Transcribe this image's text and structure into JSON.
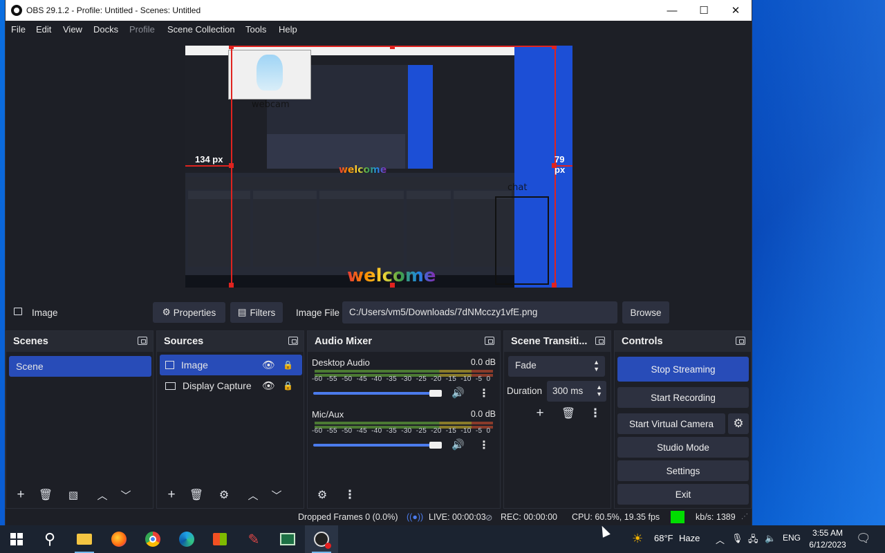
{
  "window": {
    "title": "OBS 29.1.2 - Profile: Untitled - Scenes: Untitled",
    "minimize": "—",
    "maximize": "☐",
    "close": "✕"
  },
  "menu": [
    "File",
    "Edit",
    "View",
    "Docks",
    "Profile",
    "Scene Collection",
    "Tools",
    "Help"
  ],
  "preview": {
    "left_gap_label": "134 px",
    "right_gap_label": "79 px",
    "webcam_label": "webcam",
    "welcome_text": "welcome",
    "chat_label": "chat"
  },
  "source_bar": {
    "source_name": "Image",
    "properties_label": "Properties",
    "filters_label": "Filters",
    "image_file_label": "Image File",
    "image_file_path": "C:/Users/vm5/Downloads/7dNMcczy1vfE.png",
    "browse_label": "Browse"
  },
  "scenes": {
    "title": "Scenes",
    "items": [
      "Scene"
    ]
  },
  "sources": {
    "title": "Sources",
    "items": [
      "Image",
      "Display Capture"
    ]
  },
  "audio_mixer": {
    "title": "Audio Mixer",
    "scale": [
      "-60",
      "-55",
      "-50",
      "-45",
      "-40",
      "-35",
      "-30",
      "-25",
      "-20",
      "-15",
      "-10",
      "-5",
      "0"
    ],
    "channels": [
      {
        "name": "Desktop Audio",
        "level": "0.0 dB",
        "volume": 0.93
      },
      {
        "name": "Mic/Aux",
        "level": "0.0 dB",
        "volume": 0.93
      }
    ]
  },
  "transitions": {
    "title": "Scene Transiti...",
    "selected": "Fade",
    "duration_label": "Duration",
    "duration_value": "300 ms"
  },
  "controls": {
    "title": "Controls",
    "stop_streaming": "Stop Streaming",
    "start_recording": "Start Recording",
    "start_virtual_camera": "Start Virtual Camera",
    "studio_mode": "Studio Mode",
    "settings": "Settings",
    "exit": "Exit"
  },
  "status": {
    "dropped_frames": "Dropped Frames 0 (0.0%)",
    "live": "LIVE: 00:00:03",
    "rec": "REC: 00:00:00",
    "cpu": "CPU: 60.5%, 19.35 fps",
    "kbs": "kb/s: 1389",
    "health_color": "#00dd00"
  },
  "taskbar": {
    "weather_temp": "68°F",
    "weather_desc": "Haze",
    "lang": "ENG",
    "time": "3:55 AM",
    "date": "6/12/2023"
  },
  "colors": {
    "accent": "#284cb8",
    "panel": "#1d1f26",
    "selection_red": "#e0231f"
  }
}
